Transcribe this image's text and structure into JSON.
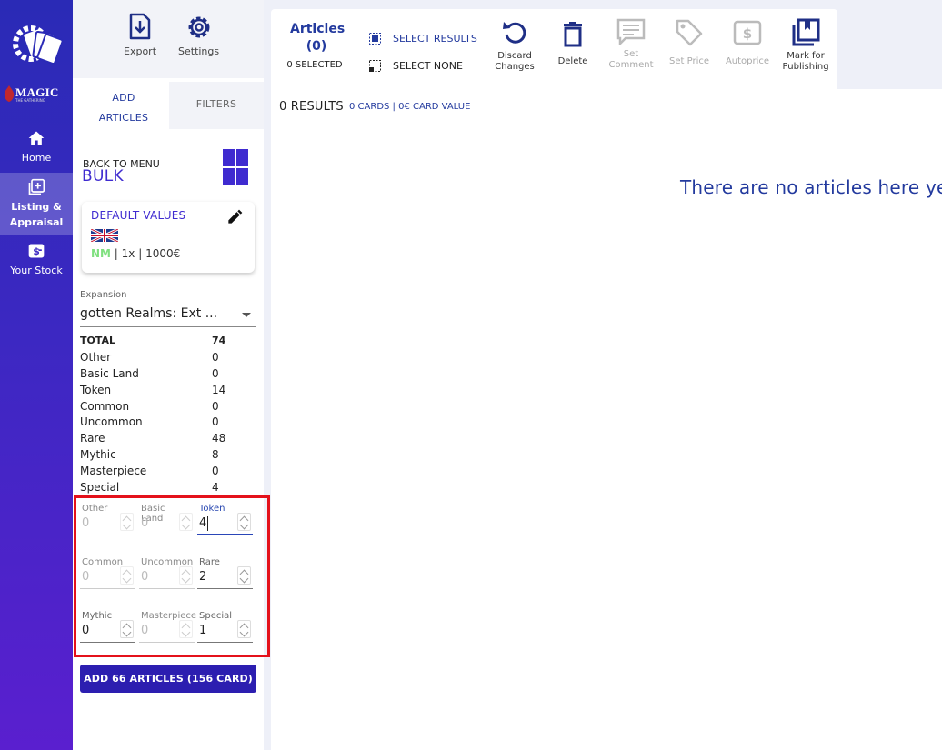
{
  "nav": {
    "brand": "MAGIC",
    "brand_sub": "THE GATHERING",
    "items": [
      {
        "label": "Home",
        "icon": "home-icon"
      },
      {
        "label": "Listing &",
        "label2": "Appraisal",
        "icon": "add-box-icon"
      },
      {
        "label": "Your Stock",
        "icon": "money-icon"
      }
    ]
  },
  "panel": {
    "export_label": "Export",
    "settings_label": "Settings",
    "tab_add_line1": "ADD",
    "tab_add_line2": "ARTICLES",
    "tab_filters": "FILTERS",
    "back_to_menu": "BACK TO MENU",
    "bulk_title": "BULK",
    "defaults": {
      "title": "DEFAULT VALUES",
      "condition": "NM",
      "rest": " | 1x | 1000€"
    },
    "expansion_label": "Expansion",
    "expansion_value": "gotten Realms: Ext ...",
    "counts": [
      {
        "name": "TOTAL",
        "count": "74"
      },
      {
        "name": "Other",
        "count": "0"
      },
      {
        "name": "Basic Land",
        "count": "0"
      },
      {
        "name": "Token",
        "count": "14"
      },
      {
        "name": "Common",
        "count": "0"
      },
      {
        "name": "Uncommon",
        "count": "0"
      },
      {
        "name": "Rare",
        "count": "48"
      },
      {
        "name": "Mythic",
        "count": "8"
      },
      {
        "name": "Masterpiece",
        "count": "0"
      },
      {
        "name": "Special",
        "count": "4"
      }
    ],
    "inputs": {
      "other": {
        "label": "Other",
        "value": "0"
      },
      "basic_land": {
        "label": "Basic Land",
        "value": "0"
      },
      "token": {
        "label": "Token",
        "value": "4"
      },
      "common": {
        "label": "Common",
        "value": "0"
      },
      "uncommon": {
        "label": "Uncommon",
        "value": "0"
      },
      "rare": {
        "label": "Rare",
        "value": "2"
      },
      "mythic": {
        "label": "Mythic",
        "value": "0"
      },
      "masterpiece": {
        "label": "Masterpiece",
        "value": "0"
      },
      "special": {
        "label": "Special",
        "value": "1"
      }
    },
    "add_button": "ADD 66 ARTICLES (156 CARD)"
  },
  "toolbar": {
    "articles_label": "Articles",
    "articles_count": "(0)",
    "selected": "0 SELECTED",
    "select_results": "SELECT RESULTS",
    "select_none": "SELECT NONE",
    "discard_1": "Discard",
    "discard_2": "Changes",
    "delete": "Delete",
    "set_comment_1": "Set",
    "set_comment_2": "Comment",
    "set_price": "Set Price",
    "autoprice": "Autoprice",
    "mark_1": "Mark for",
    "mark_2": "Publishing"
  },
  "main": {
    "results": "0 RESULTS",
    "results_sub": "0 CARDS | 0€ CARD VALUE",
    "empty_message": "There are no articles here yet."
  },
  "colors": {
    "accent": "#2c1eb0",
    "link": "#233a9e",
    "highlight_border": "#e4111b",
    "nm_green": "#7fe07f"
  }
}
